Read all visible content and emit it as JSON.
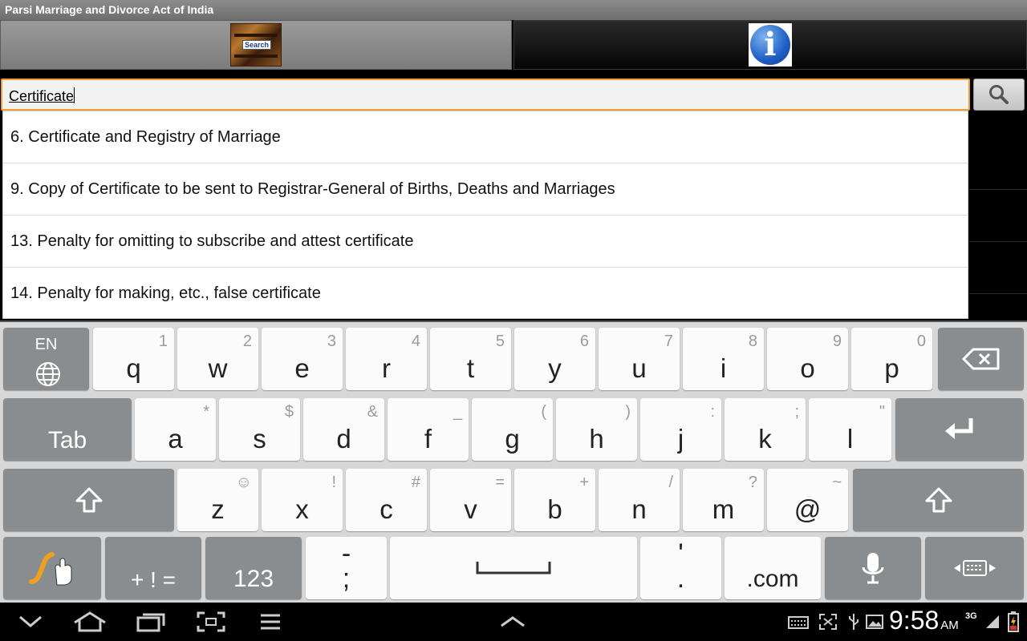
{
  "app": {
    "title": "Parsi Marriage and Divorce Act of India"
  },
  "tabs": {
    "search_image_label": "Search",
    "info_glyph": "i"
  },
  "search": {
    "value": "Certificate"
  },
  "suggestions": [
    "6. Certificate and Registry of Marriage",
    "9. Copy of Certificate to be sent to Registrar-General of Births, Deaths and Marriages",
    "13. Penalty for omitting to subscribe and attest certificate",
    "14. Penalty for making, etc., false certificate"
  ],
  "keyboard": {
    "lang": "EN",
    "row1": [
      {
        "key": "q",
        "hint": "1"
      },
      {
        "key": "w",
        "hint": "2"
      },
      {
        "key": "e",
        "hint": "3"
      },
      {
        "key": "r",
        "hint": "4"
      },
      {
        "key": "t",
        "hint": "5"
      },
      {
        "key": "y",
        "hint": "6"
      },
      {
        "key": "u",
        "hint": "7"
      },
      {
        "key": "i",
        "hint": "8"
      },
      {
        "key": "o",
        "hint": "9"
      },
      {
        "key": "p",
        "hint": "0"
      }
    ],
    "tab": "Tab",
    "row2": [
      {
        "key": "a",
        "hint": "*"
      },
      {
        "key": "s",
        "hint": "$"
      },
      {
        "key": "d",
        "hint": "&"
      },
      {
        "key": "f",
        "hint": "_"
      },
      {
        "key": "g",
        "hint": "("
      },
      {
        "key": "h",
        "hint": ")"
      },
      {
        "key": "j",
        "hint": ":"
      },
      {
        "key": "k",
        "hint": ";"
      },
      {
        "key": "l",
        "hint": "\""
      }
    ],
    "row3": [
      {
        "key": "z",
        "hint": "☺"
      },
      {
        "key": "x",
        "hint": "!"
      },
      {
        "key": "c",
        "hint": "#"
      },
      {
        "key": "v",
        "hint": "="
      },
      {
        "key": "b",
        "hint": "+"
      },
      {
        "key": "n",
        "hint": "/"
      },
      {
        "key": "m",
        "hint": "?"
      },
      {
        "key": "@",
        "hint": "~"
      }
    ],
    "symbols": "+ ! =",
    "numbers": "123",
    "dash_semicolon_top": "-",
    "dash_semicolon_bottom": ";",
    "apos_period_top": "'",
    "apos_period_bottom": ".",
    "dotcom": ".com"
  },
  "status": {
    "time": "9:58",
    "ampm": "AM",
    "network": "3G"
  },
  "colors": {
    "accent": "#f0a030",
    "info_blue": "#1e5fc4",
    "keyboard_bg": "#d7d7d7",
    "dark_key": "#8a8d90"
  }
}
